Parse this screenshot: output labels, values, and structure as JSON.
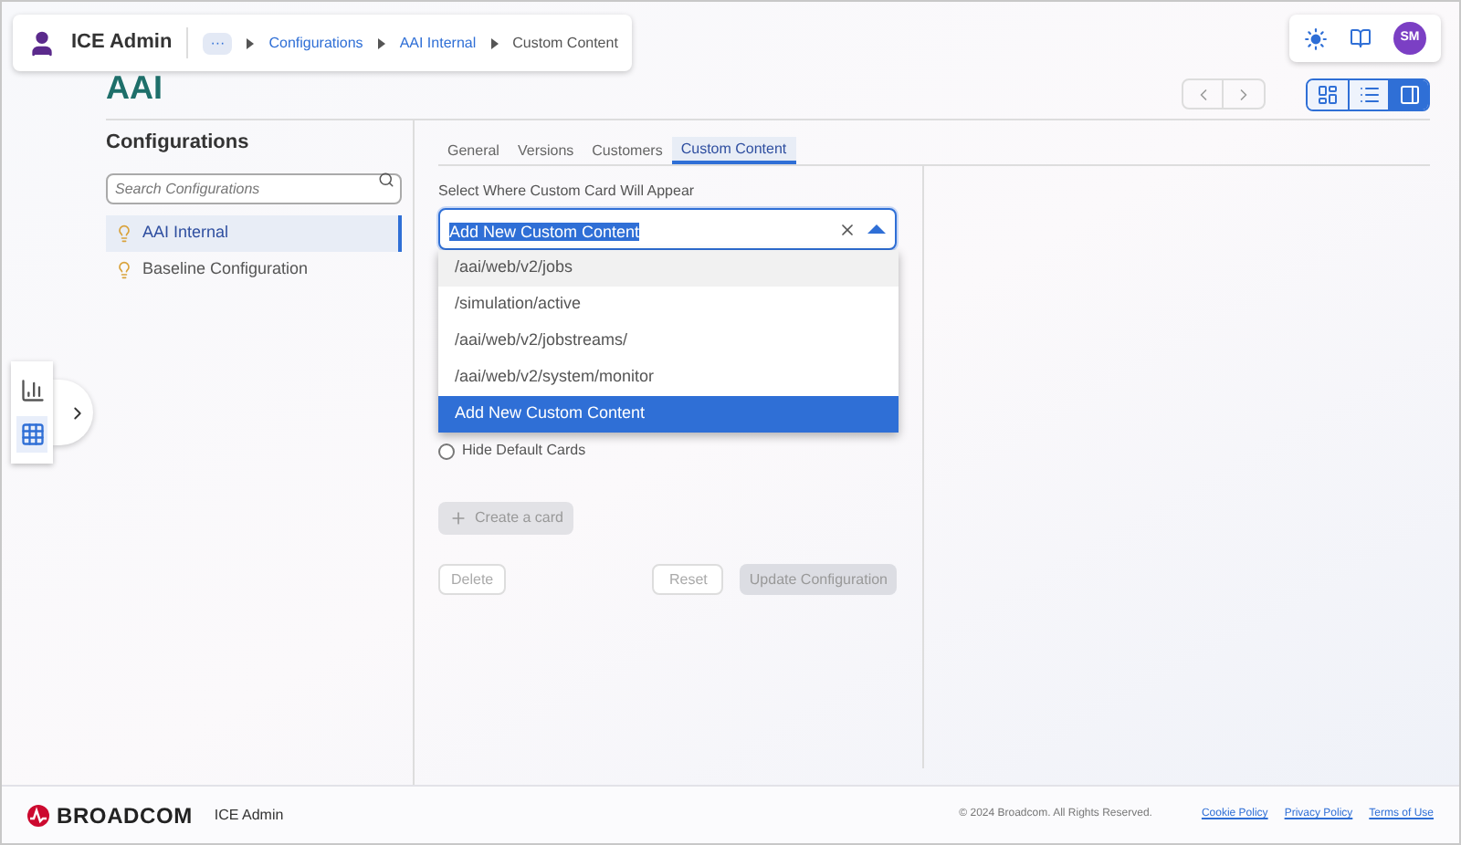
{
  "header": {
    "app_name": "ICE Admin",
    "overflow": "···",
    "breadcrumb": [
      "Configurations",
      "AAI Internal"
    ],
    "current": "Custom Content",
    "avatar": "SM"
  },
  "page_title": "AAI",
  "view_buttons": [
    {
      "kind": "grid",
      "selected": false
    },
    {
      "kind": "list",
      "selected": false
    },
    {
      "kind": "panel",
      "selected": true
    }
  ],
  "sidebar": {
    "title": "Configurations",
    "search_placeholder": "Search Configurations",
    "items": [
      {
        "label": "AAI Internal",
        "selected": true
      },
      {
        "label": "Baseline Configuration",
        "selected": false
      }
    ]
  },
  "rail": [
    {
      "kind": "chart",
      "selected": false
    },
    {
      "kind": "apps",
      "selected": true
    }
  ],
  "tabs": [
    {
      "label": "General",
      "selected": false
    },
    {
      "label": "Versions",
      "selected": false
    },
    {
      "label": "Customers",
      "selected": false
    },
    {
      "label": "Custom Content",
      "selected": true
    }
  ],
  "select": {
    "label": "Select Where Custom Card Will Appear",
    "value": "Add New Custom Content",
    "expanded": true,
    "options": [
      {
        "label": "/aai/web/v2/jobs",
        "selected": false,
        "hovered": true
      },
      {
        "label": "/simulation/active",
        "selected": false,
        "hovered": false
      },
      {
        "label": "/aai/web/v2/jobstreams/",
        "selected": false,
        "hovered": false
      },
      {
        "label": "/aai/web/v2/system/monitor",
        "selected": false,
        "hovered": false
      },
      {
        "label": "Add New Custom Content",
        "selected": true,
        "hovered": false
      }
    ]
  },
  "radio": {
    "label": "Hide Default Cards",
    "checked": false
  },
  "create_button": {
    "label": "Create a card",
    "disabled": true
  },
  "delete_button": "Delete",
  "reset_button": "Reset",
  "update_button": "Update Configuration",
  "footer": {
    "brand": "BROADCOM",
    "app": "ICE Admin",
    "copyright": "© 2024 Broadcom. All Rights Reserved.",
    "links": [
      "Cookie Policy",
      "Privacy Policy",
      "Terms of Use"
    ]
  }
}
